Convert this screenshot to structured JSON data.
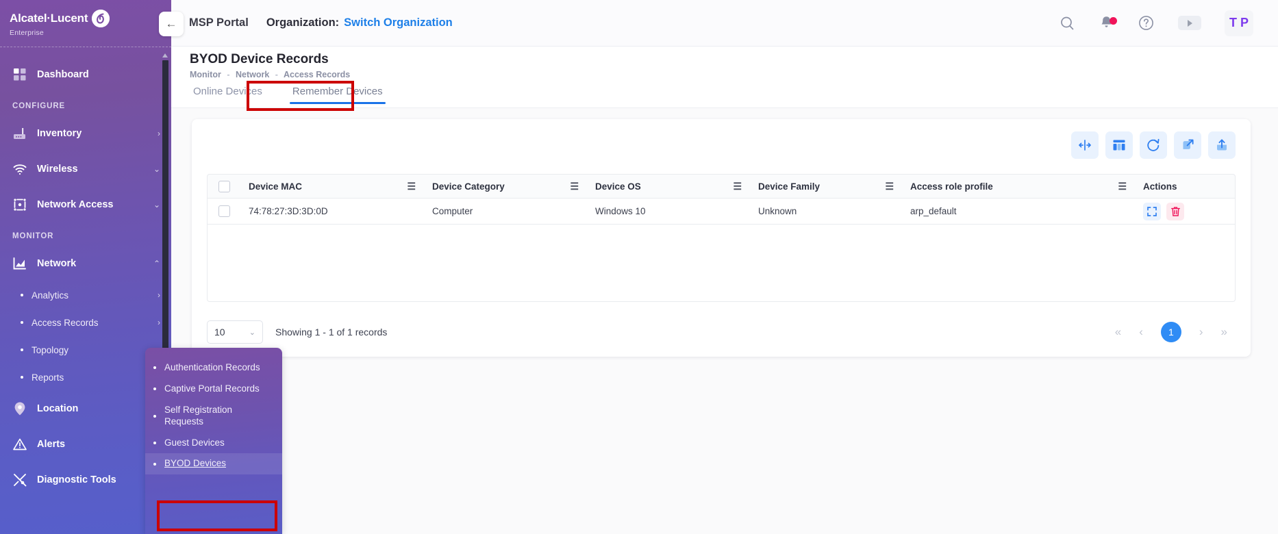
{
  "brand": {
    "name": "Alcatel·Lucent",
    "sub": "Enterprise",
    "mark": "@"
  },
  "collapse": {
    "icon": "arrow-left-icon",
    "glyph": "←"
  },
  "sidebar": {
    "dashboard": {
      "label": "Dashboard",
      "icon": "dashboard-grid-icon"
    },
    "section_configure": "CONFIGURE",
    "section_monitor": "MONITOR",
    "configure_items": [
      {
        "label": "Inventory",
        "icon": "router-icon",
        "chevron": "›"
      },
      {
        "label": "Wireless",
        "icon": "wifi-icon",
        "chevron": "⌄"
      },
      {
        "label": "Network Access",
        "icon": "network-access-icon",
        "chevron": "⌄"
      }
    ],
    "network": {
      "label": "Network",
      "icon": "chart-icon",
      "chevron": "⌃"
    },
    "network_subitems": [
      {
        "label": "Analytics",
        "chevron": "›"
      },
      {
        "label": "Access Records",
        "chevron": "›"
      },
      {
        "label": "Topology",
        "chevron": ""
      },
      {
        "label": "Reports",
        "chevron": ""
      }
    ],
    "monitor_items": [
      {
        "label": "Location",
        "icon": "location-pin-icon",
        "chevron": "›"
      },
      {
        "label": "Alerts",
        "icon": "alert-triangle-icon",
        "chevron": ""
      },
      {
        "label": "Diagnostic Tools",
        "icon": "tools-icon",
        "chevron": "›"
      }
    ]
  },
  "flyout": {
    "items": [
      {
        "label": "Authentication Records",
        "active": false
      },
      {
        "label": "Captive Portal Records",
        "active": false
      },
      {
        "label": "Self Registration Requests",
        "active": false
      },
      {
        "label": "Guest Devices",
        "active": false
      },
      {
        "label": "BYOD Devices",
        "active": true
      }
    ]
  },
  "header": {
    "portal": "MSP Portal",
    "org_label": "Organization:",
    "switch_org": "Switch Organization",
    "icons": [
      {
        "name": "search-icon"
      },
      {
        "name": "notification-bell-icon"
      },
      {
        "name": "help-circle-icon"
      },
      {
        "name": "play-video-icon"
      }
    ],
    "avatar_initials": "T P"
  },
  "page": {
    "title": "BYOD Device Records",
    "breadcrumb": [
      "Monitor",
      "Network",
      "Access Records"
    ],
    "breadcrumb_sep": "-"
  },
  "tabs": [
    {
      "label": "Online Devices",
      "active": false
    },
    {
      "label": "Remember Devices",
      "active": true
    }
  ],
  "toolbar": [
    {
      "name": "fit-columns-icon",
      "title": "Fit columns"
    },
    {
      "name": "column-settings-icon",
      "title": "Column settings"
    },
    {
      "name": "refresh-icon",
      "title": "Refresh"
    },
    {
      "name": "expand-icon",
      "title": "Expand"
    },
    {
      "name": "export-upload-icon",
      "title": "Export"
    }
  ],
  "table": {
    "columns": [
      "Device MAC",
      "Device Category",
      "Device OS",
      "Device Family",
      "Access role profile"
    ],
    "actions_column": "Actions",
    "rows": [
      {
        "mac": "74:78:27:3D:3D:0D",
        "category": "Computer",
        "os": "Windows 10",
        "family": "Unknown",
        "role": "arp_default"
      }
    ],
    "row_actions": [
      {
        "name": "expand-row-icon"
      },
      {
        "name": "delete-row-icon"
      }
    ]
  },
  "footer": {
    "page_size": "10",
    "page_size_chevron": "⌄",
    "showing": "Showing 1 - 1 of 1 records",
    "pager": {
      "first": "«",
      "prev": "‹",
      "current": "1",
      "next": "›",
      "last": "»"
    }
  },
  "colors": {
    "sidebar_top": "#7c4fa6",
    "sidebar_bottom": "#565fcb",
    "link_blue": "#1d7fe8",
    "accent_blue": "#2f8cf5",
    "highlight_red": "#cc0000",
    "danger_red": "#f0145a",
    "avatar_purple": "#7c3aed"
  }
}
